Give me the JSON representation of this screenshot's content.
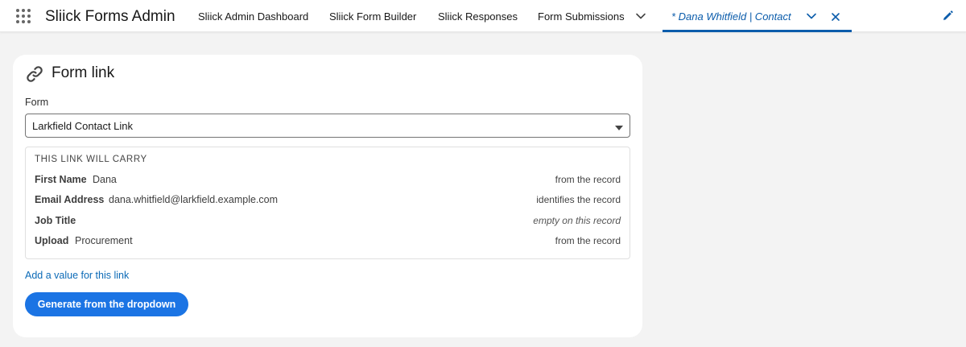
{
  "header": {
    "app_name": "Sliick Forms Admin",
    "tabs": [
      {
        "label": "Sliick Admin Dashboard"
      },
      {
        "label": "Sliick Form Builder"
      },
      {
        "label": "Sliick Responses"
      },
      {
        "label": "Form Submissions"
      }
    ],
    "active_tab": {
      "label": "* Dana Whitfield | Contact"
    }
  },
  "card": {
    "title": "Form link",
    "form_field": {
      "label": "Form",
      "selected": "Larkfield Contact Link"
    },
    "carry": {
      "heading": "THIS LINK WILL CARRY",
      "rows": [
        {
          "label": "First Name",
          "value": "Dana",
          "note": "from the record"
        },
        {
          "label": "Email Address",
          "value": "dana.whitfield@larkfield.example.com",
          "note": "identifies the record"
        },
        {
          "label": "Job Title",
          "value": "",
          "note": "empty on this record"
        },
        {
          "label": "Upload",
          "value": "Procurement",
          "note": "from the record"
        }
      ]
    },
    "add_value_link": "Add a value for this link",
    "generate_button": "Generate from the dropdown"
  },
  "colors": {
    "brand_blue": "#0b5cab",
    "button_blue": "#1b74e4",
    "link_blue": "#0b6ab7"
  },
  "icons": [
    "app-launcher-icon",
    "chevron-down-icon",
    "close-icon",
    "pencil-icon",
    "link-icon",
    "caret-down-icon"
  ]
}
